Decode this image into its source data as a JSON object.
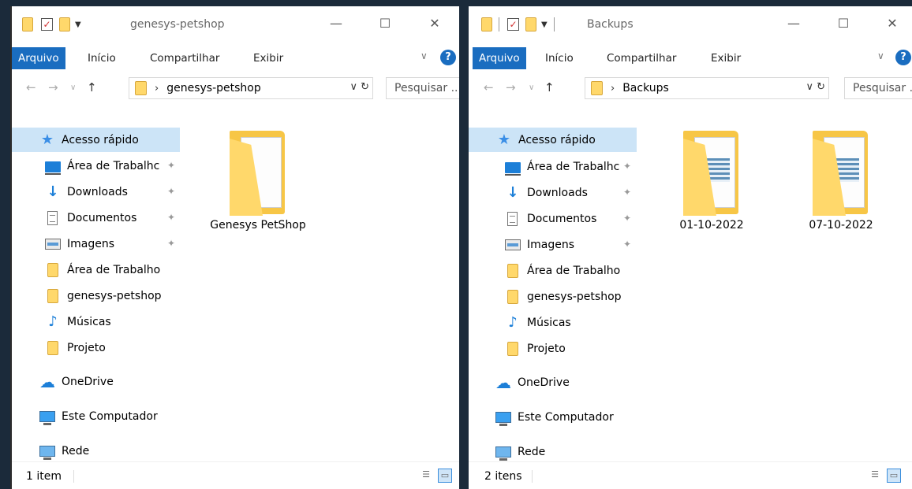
{
  "windows": [
    {
      "title": "genesys-petshop",
      "ribbon": {
        "file": "Arquivo",
        "home": "Início",
        "share": "Compartilhar",
        "view": "Exibir"
      },
      "address": {
        "path": "genesys-petshop"
      },
      "search": {
        "placeholder": "Pesquisar ..."
      },
      "nav": [
        {
          "label": "Acesso rápido",
          "icon": "star-icon",
          "selected": true
        },
        {
          "label": "Área de Trabalhc",
          "icon": "desktop-icon",
          "pinned": true
        },
        {
          "label": "Downloads",
          "icon": "download-icon",
          "pinned": true
        },
        {
          "label": "Documentos",
          "icon": "document-icon",
          "pinned": true
        },
        {
          "label": "Imagens",
          "icon": "pictures-icon",
          "pinned": true
        },
        {
          "label": "Área de Trabalho",
          "icon": "folder-icon"
        },
        {
          "label": "genesys-petshop",
          "icon": "folder-icon"
        },
        {
          "label": "Músicas",
          "icon": "music-icon"
        },
        {
          "label": "Projeto",
          "icon": "folder-icon"
        },
        {
          "label": "OneDrive",
          "icon": "cloud-icon"
        },
        {
          "label": "Este Computador",
          "icon": "computer-icon"
        },
        {
          "label": "Rede",
          "icon": "network-icon"
        }
      ],
      "items": [
        {
          "name": "Genesys PetShop"
        }
      ],
      "status": "1 item"
    },
    {
      "title": "Backups",
      "ribbon": {
        "file": "Arquivo",
        "home": "Início",
        "share": "Compartilhar",
        "view": "Exibir"
      },
      "address": {
        "path": "Backups"
      },
      "search": {
        "placeholder": "Pesquisar ..."
      },
      "nav": [
        {
          "label": "Acesso rápido",
          "icon": "star-icon",
          "selected": true
        },
        {
          "label": "Área de Trabalhc",
          "icon": "desktop-icon",
          "pinned": true
        },
        {
          "label": "Downloads",
          "icon": "download-icon",
          "pinned": true
        },
        {
          "label": "Documentos",
          "icon": "document-icon",
          "pinned": true
        },
        {
          "label": "Imagens",
          "icon": "pictures-icon",
          "pinned": true
        },
        {
          "label": "Área de Trabalho",
          "icon": "folder-icon"
        },
        {
          "label": "genesys-petshop",
          "icon": "folder-icon"
        },
        {
          "label": "Músicas",
          "icon": "music-icon"
        },
        {
          "label": "Projeto",
          "icon": "folder-icon"
        },
        {
          "label": "OneDrive",
          "icon": "cloud-icon"
        },
        {
          "label": "Este Computador",
          "icon": "computer-icon"
        },
        {
          "label": "Rede",
          "icon": "network-icon"
        }
      ],
      "items": [
        {
          "name": "01-10-2022"
        },
        {
          "name": "07-10-2022"
        }
      ],
      "status": "2 itens"
    }
  ],
  "colors": {
    "accent": "#1a6dc0",
    "selection": "#cce4f7",
    "folder": "#ffd86b"
  }
}
